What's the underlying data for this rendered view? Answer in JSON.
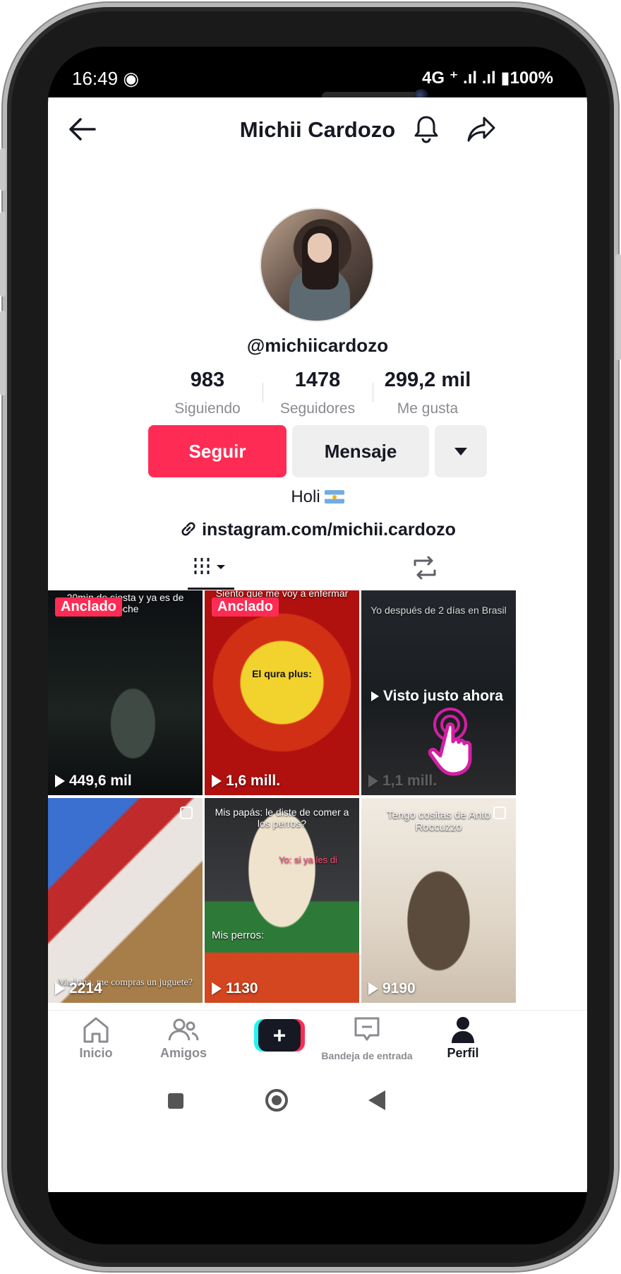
{
  "status": {
    "time": "16:49",
    "indicators": "4G ⁺ .ıl .ıl",
    "battery": "100%"
  },
  "header": {
    "title": "Michii Cardozo"
  },
  "profile": {
    "handle": "@michiicardozo",
    "stats": [
      {
        "value": "983",
        "label": "Siguiendo"
      },
      {
        "value": "1478",
        "label": "Seguidores"
      },
      {
        "value": "299,2 mil",
        "label": "Me gusta"
      }
    ],
    "follow_label": "Seguir",
    "message_label": "Mensaje",
    "bio": "Holi",
    "link": "instagram.com/michii.cardozo"
  },
  "videos": [
    {
      "views": "449,6 mil",
      "pinned": "Anclado",
      "caption": "20min de siesta y ya es de noche"
    },
    {
      "views": "1,6 mill.",
      "pinned": "Anclado",
      "caption": "Siento que me voy a enfermar",
      "caption2": "El qura plus:"
    },
    {
      "views": "1,1 mill.",
      "seen": "Visto justo ahora",
      "caption": "Yo después de 2 días en Brasil"
    },
    {
      "views": "2214",
      "caption": "Madrina, me compras un juguete?"
    },
    {
      "views": "1130",
      "caption": "Mis papás: le diste de comer a los perros?",
      "caption2": "Yo: si ya les di",
      "caption3": "Mis perros:"
    },
    {
      "views": "9190",
      "caption": "Tengo cositas de Anto Roccuzzo"
    }
  ],
  "nav": [
    {
      "label": "Inicio",
      "icon": "home-icon"
    },
    {
      "label": "Amigos",
      "icon": "friends-icon"
    },
    {
      "label": "",
      "icon": "plus-icon"
    },
    {
      "label": "Bandeja de entrada",
      "icon": "inbox-icon"
    },
    {
      "label": "Perfil",
      "icon": "profile-icon"
    }
  ],
  "colors": {
    "accent": "#fe2c55",
    "text": "#161823",
    "muted": "#8a8b91"
  }
}
